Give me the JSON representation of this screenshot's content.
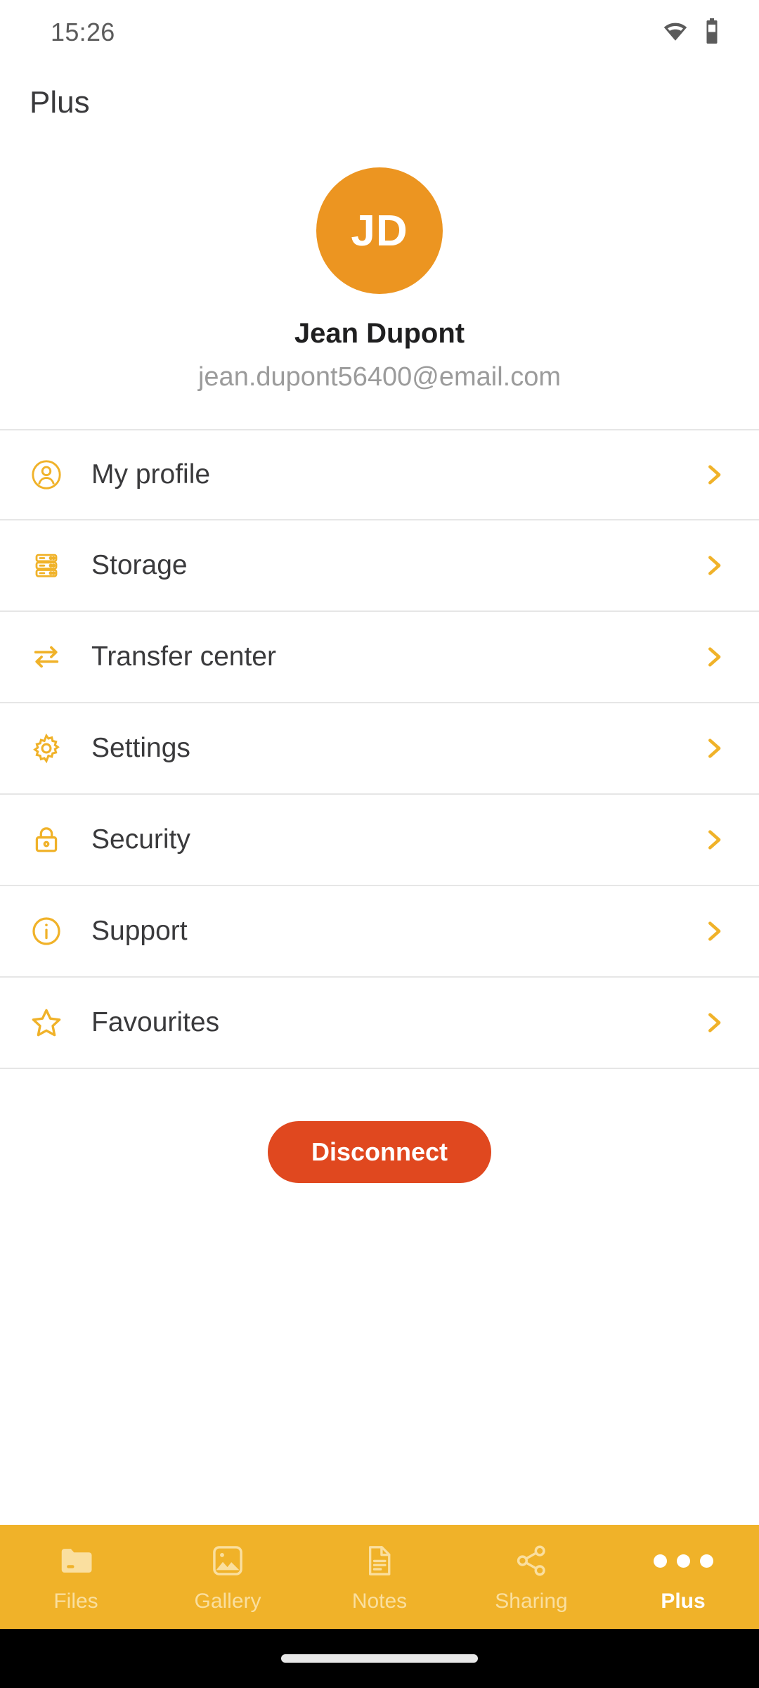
{
  "status_bar": {
    "time": "15:26",
    "wifi_icon": "wifi-icon",
    "battery_icon": "battery-icon"
  },
  "header": {
    "title": "Plus"
  },
  "profile": {
    "initials": "JD",
    "name": "Jean Dupont",
    "email": "jean.dupont56400@email.com",
    "avatar_color": "#ec9521"
  },
  "menu": {
    "items": [
      {
        "label": "My profile",
        "icon": "user-circle-icon",
        "chevron": "chevron-right-icon"
      },
      {
        "label": "Storage",
        "icon": "server-stack-icon",
        "chevron": "chevron-right-icon"
      },
      {
        "label": "Transfer center",
        "icon": "transfer-arrows-icon",
        "chevron": "chevron-right-icon"
      },
      {
        "label": "Settings",
        "icon": "gear-icon",
        "chevron": "chevron-right-icon"
      },
      {
        "label": "Security",
        "icon": "lock-icon",
        "chevron": "chevron-right-icon"
      },
      {
        "label": "Support",
        "icon": "info-circle-icon",
        "chevron": "chevron-right-icon"
      },
      {
        "label": "Favourites",
        "icon": "star-icon",
        "chevron": "chevron-right-icon"
      }
    ]
  },
  "actions": {
    "disconnect_label": "Disconnect",
    "disconnect_color": "#e0481f"
  },
  "bottom_nav": {
    "accent_color": "#f0b229",
    "items": [
      {
        "label": "Files",
        "icon": "folder-icon",
        "active": false
      },
      {
        "label": "Gallery",
        "icon": "image-icon",
        "active": false
      },
      {
        "label": "Notes",
        "icon": "document-icon",
        "active": false
      },
      {
        "label": "Sharing",
        "icon": "share-icon",
        "active": false
      },
      {
        "label": "Plus",
        "icon": "dots-icon",
        "active": true
      }
    ]
  }
}
